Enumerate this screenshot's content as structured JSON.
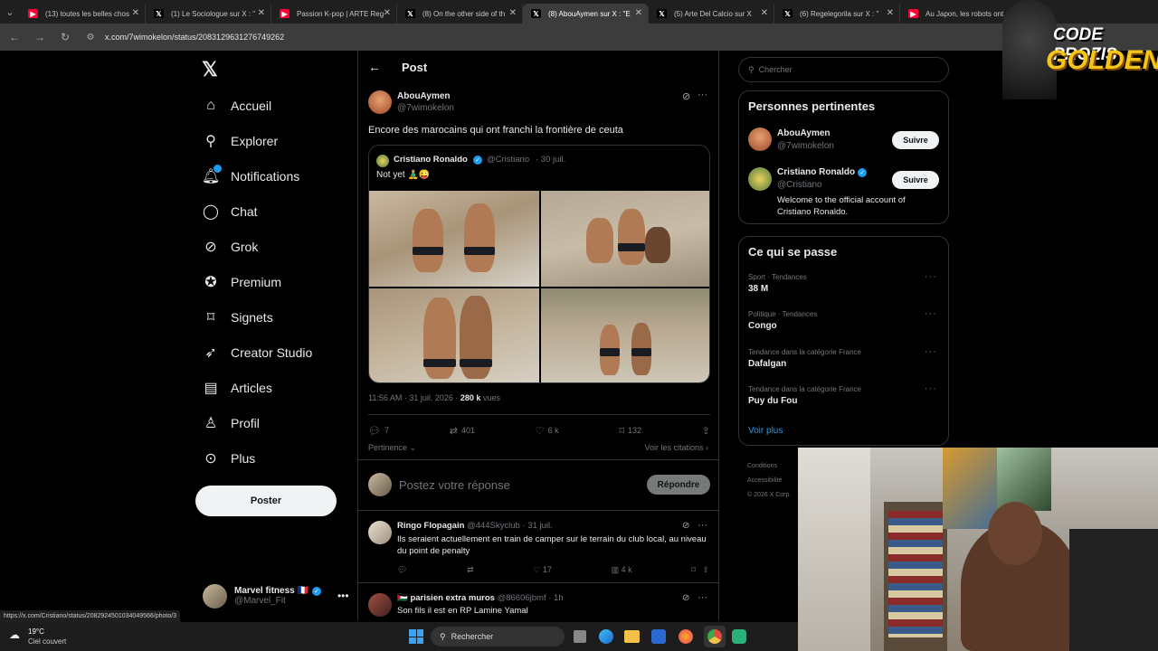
{
  "browser": {
    "tabs": [
      {
        "label": "(13) toutes les belles chos",
        "fav": "▶",
        "color": "#ff0033"
      },
      {
        "label": "(1) Le Sociologue sur X : \"",
        "fav": "𝕏",
        "color": "#000000"
      },
      {
        "label": "Passion K-pop | ARTE Reg",
        "fav": "▶",
        "color": "#ff0033"
      },
      {
        "label": "(8) On the other side of th",
        "fav": "𝕏",
        "color": "#000000"
      },
      {
        "label": "(8) AbouAymen sur X : \"E",
        "fav": "𝕏",
        "color": "#000000",
        "active": true
      },
      {
        "label": "(5) Arte Del Calcio sur X",
        "fav": "𝕏",
        "color": "#000000"
      },
      {
        "label": "(6) Regelegorila sur X : \"",
        "fav": "𝕏",
        "color": "#000000"
      },
      {
        "label": "Au Japon, les robots ont",
        "fav": "▶",
        "color": "#ff0033"
      }
    ],
    "url": "x.com/7wimokelon/status/2083129631276749262",
    "status_url": "https://x.com/Cristiano/status/2082924501034049566/photo/3"
  },
  "sidebar": {
    "logo": "𝕏",
    "items": [
      {
        "label": "Accueil",
        "icon": "home-icon"
      },
      {
        "label": "Explorer",
        "icon": "search-icon"
      },
      {
        "label": "Notifications",
        "icon": "bell-icon"
      },
      {
        "label": "Chat",
        "icon": "chat-icon"
      },
      {
        "label": "Grok",
        "icon": "grok-icon"
      },
      {
        "label": "Premium",
        "icon": "premium-icon"
      },
      {
        "label": "Signets",
        "icon": "bookmark-icon"
      },
      {
        "label": "Creator Studio",
        "icon": "rocket-icon"
      },
      {
        "label": "Articles",
        "icon": "article-icon"
      },
      {
        "label": "Profil",
        "icon": "person-icon"
      },
      {
        "label": "Plus",
        "icon": "more-icon"
      }
    ],
    "post_button": "Poster",
    "account": {
      "name": "Marvel fitness 🇫🇷",
      "handle": "@Marvel_Fit"
    }
  },
  "post": {
    "header_title": "Post",
    "author": "AbouAymen",
    "handle": "@7wimokelon",
    "text": "Encore des marocains qui ont franchi la frontière de ceuta",
    "quote": {
      "author": "Cristiano Ronaldo",
      "handle": "@Cristiano",
      "date": "· 30 juil.",
      "text": "Not yet 🧘‍♂️😜"
    },
    "meta_time": "11:56 AM · 31 juil. 2026 · ",
    "meta_views": "280 k",
    "meta_views_label": " vues",
    "stats": {
      "replies": "7",
      "reposts": "401",
      "likes": "6 k",
      "bookmarks": "132"
    },
    "sort_label": "Pertinence",
    "citations_label": "Voir les citations",
    "reply_placeholder": "Postez votre réponse",
    "reply_button": "Répondre"
  },
  "replies": [
    {
      "author": "Ringo Flopagain",
      "handle": "@444Skyclub",
      "date": "· 31 juil.",
      "text": "Ils seraient actuellement en train de camper sur le terrain du club local, au niveau du point de penalty",
      "likes": "17",
      "views": "4 k"
    },
    {
      "author": "🇵🇸 parisien extra muros",
      "handle": "@86606jbmf",
      "date": "· 1h",
      "text": "Son fils il est en RP Lamine Yamal"
    }
  ],
  "right": {
    "search_placeholder": "Chercher",
    "relevant_title": "Personnes pertinentes",
    "people": [
      {
        "name": "AbouAymen",
        "handle": "@7wimokelon",
        "bio": "",
        "button": "Suivre"
      },
      {
        "name": "Cristiano Ronaldo",
        "handle": "@Cristiano",
        "bio": "Welcome to the official account of Cristiano Ronaldo.",
        "button": "Suivre"
      }
    ],
    "trends_title": "Ce qui se passe",
    "trends": [
      {
        "category": "Sport · Tendances",
        "name": "38 M"
      },
      {
        "category": "Politique · Tendances",
        "name": "Congo"
      },
      {
        "category": "Tendance dans la catégorie France",
        "name": "Dafalgan"
      },
      {
        "category": "Tendance dans la catégorie France",
        "name": "Puy du Fou"
      }
    ],
    "see_more": "Voir plus",
    "footer": [
      "Conditions",
      "Accessibilité",
      "© 2026 X Corp."
    ]
  },
  "overlay": {
    "logo_line1": "CODE PROZIS",
    "logo_line2": "GOLDENG"
  },
  "taskbar": {
    "weather_temp": "19°C",
    "weather_desc": "Ciel couvert",
    "search": "Rechercher"
  }
}
